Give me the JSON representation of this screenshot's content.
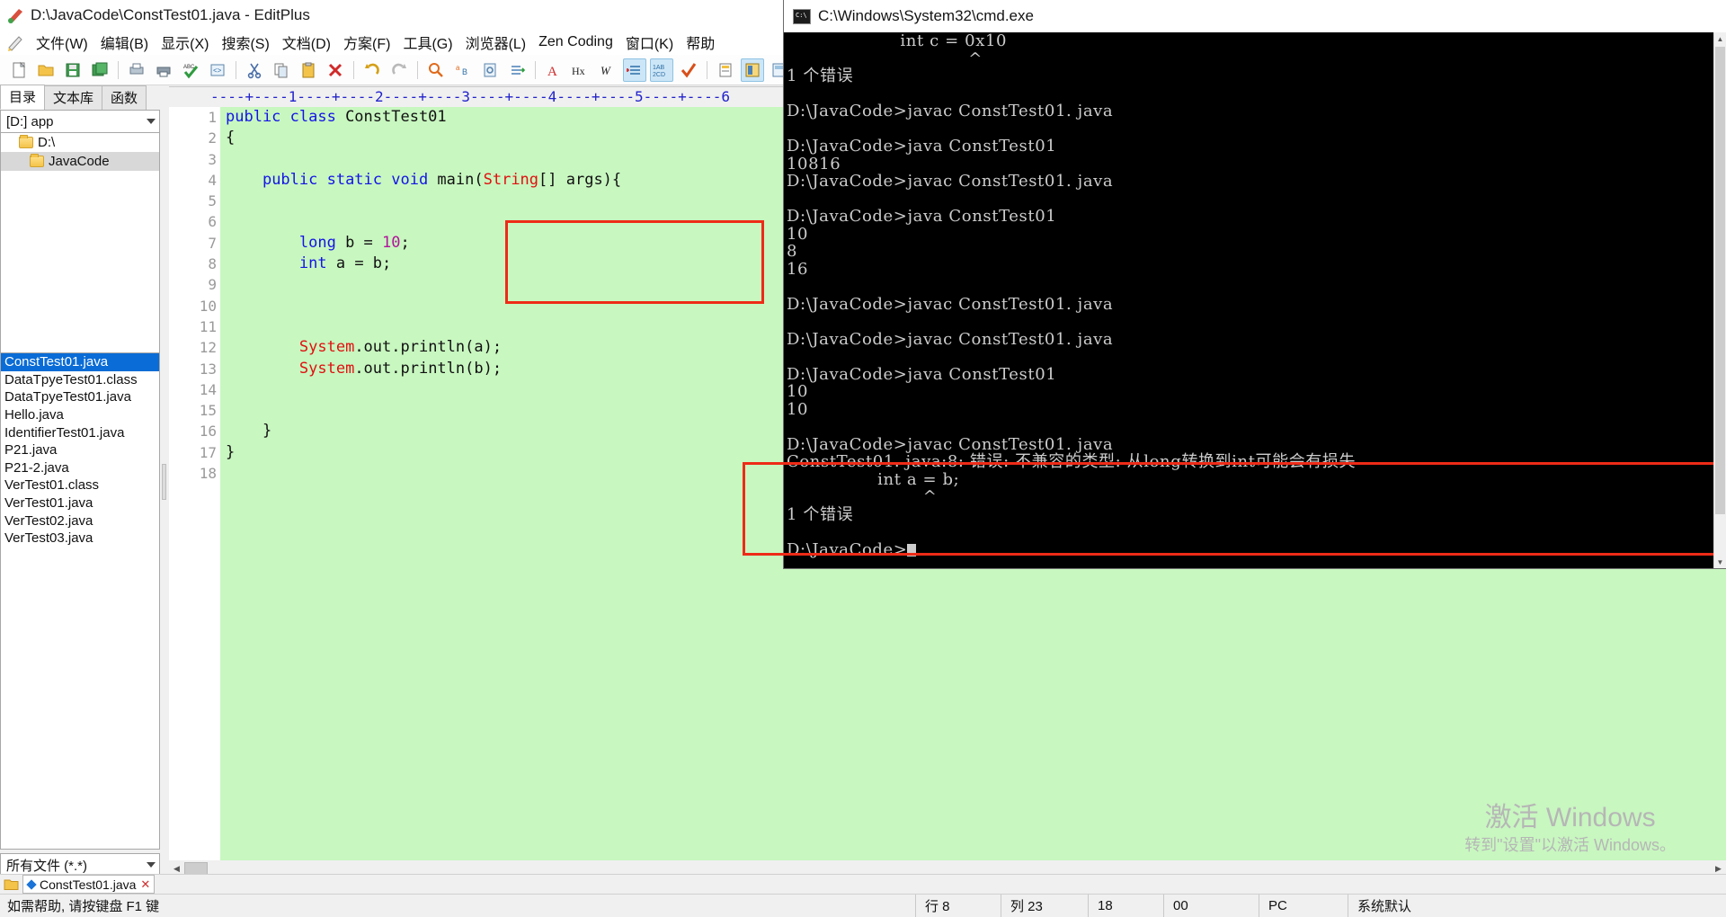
{
  "editplus": {
    "title": "D:\\JavaCode\\ConstTest01.java - EditPlus",
    "title_icon": "editplus-logo-icon",
    "menu": [
      {
        "label": "文件(W)"
      },
      {
        "label": "编辑(B)"
      },
      {
        "label": "显示(X)"
      },
      {
        "label": "搜索(S)"
      },
      {
        "label": "文档(D)"
      },
      {
        "label": "方案(F)"
      },
      {
        "label": "工具(G)"
      },
      {
        "label": "浏览器(L)"
      },
      {
        "label": "Zen Coding"
      },
      {
        "label": "窗口(K)"
      },
      {
        "label": "帮助"
      }
    ],
    "toolbar": [
      {
        "name": "new-file-icon",
        "glyph": "🗋"
      },
      {
        "name": "open-file-icon",
        "glyph": "📂"
      },
      {
        "name": "save-file-icon",
        "glyph": "💾"
      },
      {
        "name": "save-all-icon",
        "glyph": "🖫"
      },
      {
        "name": "print-preview-icon",
        "glyph": "🖶"
      },
      {
        "name": "print-icon",
        "glyph": "🖨"
      },
      {
        "name": "spellcheck-icon",
        "glyph": "✓"
      },
      {
        "name": "browser-preview-icon",
        "glyph": "<>"
      },
      {
        "name": "cut-icon",
        "glyph": "✂"
      },
      {
        "name": "copy-icon",
        "glyph": "🗐"
      },
      {
        "name": "paste-icon",
        "glyph": "📋"
      },
      {
        "name": "delete-icon",
        "glyph": "✕"
      },
      {
        "name": "undo-icon",
        "glyph": "↺"
      },
      {
        "name": "redo-icon",
        "glyph": "↻"
      },
      {
        "name": "find-icon",
        "glyph": "🔍"
      },
      {
        "name": "replace-icon",
        "glyph": "ab"
      },
      {
        "name": "find-in-files-icon",
        "glyph": "🗒"
      },
      {
        "name": "goto-line-icon",
        "glyph": "⇥"
      },
      {
        "name": "font-icon",
        "glyph": "A"
      },
      {
        "name": "hex-view-icon",
        "glyph": "Hx"
      },
      {
        "name": "word-wrap-icon",
        "glyph": "W"
      },
      {
        "name": "indent-icon",
        "glyph": "≡"
      },
      {
        "name": "case-convert-icon",
        "glyph": "AB"
      },
      {
        "name": "check-icon",
        "glyph": "✔"
      },
      {
        "name": "document-selector-icon",
        "glyph": "▤"
      },
      {
        "name": "output-window-icon",
        "glyph": "▦"
      },
      {
        "name": "clipboard-window-icon",
        "glyph": "▣"
      },
      {
        "name": "open-browser-icon",
        "glyph": "▧"
      },
      {
        "name": "context-help-icon",
        "glyph": "?"
      }
    ],
    "left_panel": {
      "tabs": [
        {
          "label": "目录",
          "active": true
        },
        {
          "label": "文本库",
          "active": false
        },
        {
          "label": "函数",
          "active": false
        }
      ],
      "drive_combo": "[D:] app",
      "tree": [
        {
          "label": "D:\\",
          "indent": 0,
          "selected": false
        },
        {
          "label": "JavaCode",
          "indent": 1,
          "selected": true
        }
      ],
      "files": [
        {
          "name": "ConstTest01.java",
          "selected": true
        },
        {
          "name": "DataTpyeTest01.class",
          "selected": false
        },
        {
          "name": "DataTpyeTest01.java",
          "selected": false
        },
        {
          "name": "Hello.java",
          "selected": false
        },
        {
          "name": "IdentifierTest01.java",
          "selected": false
        },
        {
          "name": "P21.java",
          "selected": false
        },
        {
          "name": "P21-2.java",
          "selected": false
        },
        {
          "name": "VerTest01.class",
          "selected": false
        },
        {
          "name": "VerTest01.java",
          "selected": false
        },
        {
          "name": "VerTest02.java",
          "selected": false
        },
        {
          "name": "VerTest03.java",
          "selected": false
        }
      ],
      "filter": "所有文件 (*.*)"
    },
    "editor": {
      "ruler": "----+----1----+----2----+----3----+----4----+----5----+----6",
      "lines": [
        {
          "n": 1,
          "fold": false,
          "segments": [
            {
              "t": "public class ",
              "c": "kw"
            },
            {
              "t": "ConstTest01",
              "c": ""
            }
          ]
        },
        {
          "n": 2,
          "fold": true,
          "segments": [
            {
              "t": "{",
              "c": ""
            }
          ]
        },
        {
          "n": 3,
          "fold": false,
          "segments": []
        },
        {
          "n": 4,
          "fold": true,
          "segments": [
            {
              "t": "    ",
              "c": ""
            },
            {
              "t": "public static void ",
              "c": "kw"
            },
            {
              "t": "main(",
              "c": ""
            },
            {
              "t": "String",
              "c": "cls"
            },
            {
              "t": "[] args){",
              "c": ""
            }
          ]
        },
        {
          "n": 5,
          "fold": false,
          "segments": []
        },
        {
          "n": 6,
          "fold": false,
          "segments": []
        },
        {
          "n": 7,
          "fold": false,
          "segments": [
            {
              "t": "        ",
              "c": ""
            },
            {
              "t": "long",
              "c": "kw"
            },
            {
              "t": " b = ",
              "c": ""
            },
            {
              "t": "10",
              "c": "num"
            },
            {
              "t": ";",
              "c": ""
            }
          ]
        },
        {
          "n": 8,
          "fold": false,
          "segments": [
            {
              "t": "        ",
              "c": ""
            },
            {
              "t": "int",
              "c": "kw"
            },
            {
              "t": " a = b;",
              "c": ""
            }
          ]
        },
        {
          "n": 9,
          "fold": false,
          "segments": []
        },
        {
          "n": 10,
          "fold": false,
          "segments": []
        },
        {
          "n": 11,
          "fold": false,
          "segments": []
        },
        {
          "n": 12,
          "fold": false,
          "segments": [
            {
              "t": "        ",
              "c": ""
            },
            {
              "t": "System",
              "c": "cls"
            },
            {
              "t": ".out.println(a);",
              "c": ""
            }
          ]
        },
        {
          "n": 13,
          "fold": false,
          "segments": [
            {
              "t": "        ",
              "c": ""
            },
            {
              "t": "System",
              "c": "cls"
            },
            {
              "t": ".out.println(b);",
              "c": ""
            }
          ]
        },
        {
          "n": 14,
          "fold": false,
          "segments": []
        },
        {
          "n": 15,
          "fold": false,
          "segments": []
        },
        {
          "n": 16,
          "fold": false,
          "segments": [
            {
              "t": "    }",
              "c": ""
            }
          ]
        },
        {
          "n": 17,
          "fold": false,
          "segments": [
            {
              "t": "}",
              "c": ""
            }
          ]
        },
        {
          "n": 18,
          "fold": false,
          "segments": []
        }
      ],
      "highlight_color": "#ee2b17",
      "background_color": "#c8f7c0"
    },
    "watermark": {
      "line1": "激活 Windows",
      "line2": "转到\"设置\"以激活 Windows。"
    },
    "tabstrip": {
      "tab_label": "ConstTest01.java",
      "close_glyph": "✕"
    },
    "status": {
      "hint": "如需帮助, 请按键盘 F1 键",
      "line": "行 8",
      "column": "列 23",
      "value1": "18",
      "value2": "00",
      "pc": "PC",
      "encoding": "系统默认"
    }
  },
  "cmd": {
    "title": "C:\\Windows\\System32\\cmd.exe",
    "icon": "cmd-console-icon",
    "lines": [
      "                    int c = 0x10",
      "                                ^",
      "1 个错误",
      "",
      "D:\\JavaCode>javac ConstTest01. java",
      "",
      "D:\\JavaCode>java ConstTest01",
      "10816",
      "D:\\JavaCode>javac ConstTest01. java",
      "",
      "D:\\JavaCode>java ConstTest01",
      "10",
      "8",
      "16",
      "",
      "D:\\JavaCode>javac ConstTest01. java",
      "",
      "D:\\JavaCode>javac ConstTest01. java",
      "",
      "D:\\JavaCode>java ConstTest01",
      "10",
      "10",
      "",
      "D:\\JavaCode>javac ConstTest01. java",
      "ConstTest01. java:8: 错误: 不兼容的类型: 从long转换到int可能会有损失",
      "                int a = b;",
      "                        ^",
      "1 个错误",
      ""
    ],
    "prompt": "D:\\JavaCode>",
    "highlight_color": "#ee2b17"
  }
}
